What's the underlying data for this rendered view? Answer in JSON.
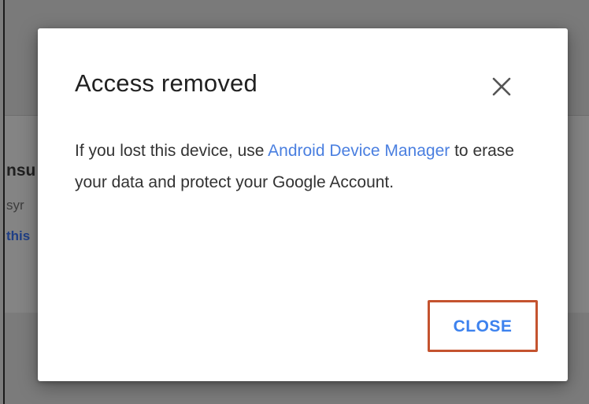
{
  "background": {
    "heading_fragment": "nsu",
    "subtext_fragment": "syr",
    "link_fragment": "this"
  },
  "dialog": {
    "title": "Access removed",
    "close_icon": "close-icon",
    "body": {
      "text_1": "If you lost this device, use ",
      "link_text": "Android Device Manager",
      "text_2": " to erase your data and protect your Google Account."
    },
    "close_button_label": "CLOSE"
  },
  "colors": {
    "link": "#4a7fe0",
    "button": "#3d82ee",
    "highlight": "#c4532f"
  }
}
